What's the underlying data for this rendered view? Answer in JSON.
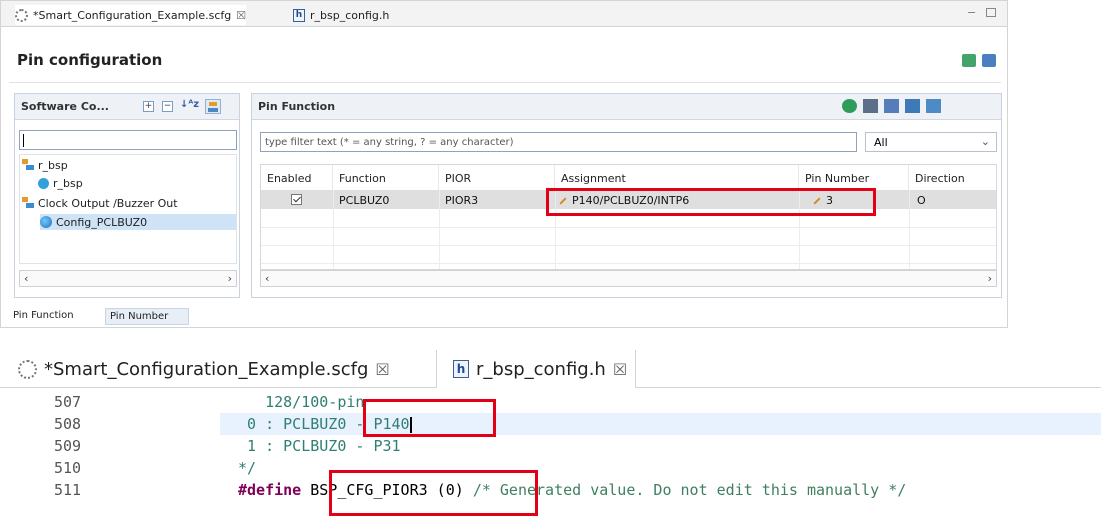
{
  "top_editor": {
    "tabs": [
      {
        "label": "*Smart_Configuration_Example.scfg",
        "close": "☒"
      },
      {
        "label": "r_bsp_config.h"
      }
    ],
    "page_title": "Pin configuration",
    "left_panel": {
      "title": "Software Co...",
      "search_value": "",
      "tree": [
        {
          "label": "r_bsp"
        },
        {
          "label": "r_bsp"
        },
        {
          "label": "Clock Output /Buzzer Out"
        },
        {
          "label": "Config_PCLBUZ0"
        }
      ]
    },
    "right_panel": {
      "title": "Pin Function",
      "filter_placeholder": "type filter text (* = any string, ? = any character)",
      "filter_select_value": "All",
      "columns": [
        "Enabled",
        "Function",
        "PIOR",
        "Assignment",
        "Pin Number",
        "Direction"
      ],
      "rows": [
        {
          "enabled": true,
          "function": "PCLBUZ0",
          "pior": "PIOR3",
          "assignment": "P140/PCLBUZ0/INTP6",
          "pin_number": "3",
          "direction": "O"
        }
      ]
    },
    "bottom_tabs": [
      "Pin Function",
      "Pin Number"
    ]
  },
  "source_editor": {
    "tabs": [
      {
        "label": "*Smart_Configuration_Example.scfg",
        "close": "☒"
      },
      {
        "label": "r_bsp_config.h",
        "close": "☒"
      }
    ],
    "lines": [
      {
        "number": "507",
        "text": "   128/100-pin"
      },
      {
        "number": "508",
        "text_a": " 0 : PCLBUZ0 ",
        "text_b": "- P140"
      },
      {
        "number": "509",
        "text": " 1 : PCLBUZ0 - P31"
      },
      {
        "number": "510",
        "text": "*/"
      },
      {
        "number": "511",
        "keyword": "#define",
        "macro": "BSP_CFG_PIOR3 (0)",
        "comment": "/* Generated value. Do not edit this manually */"
      }
    ]
  },
  "colors": {
    "highlight_box": "#e30016",
    "selected_row": "#dfdfdf",
    "code_line_highlight": "#e8f2fe"
  },
  "icons": [
    "gear-icon",
    "h-file-icon",
    "close-icon",
    "expand-all-icon",
    "collapse-all-icon",
    "sort-icon",
    "tree-view-icon",
    "refresh-icon",
    "grid-icon",
    "export-icon",
    "import-icon",
    "pencil-icon"
  ]
}
